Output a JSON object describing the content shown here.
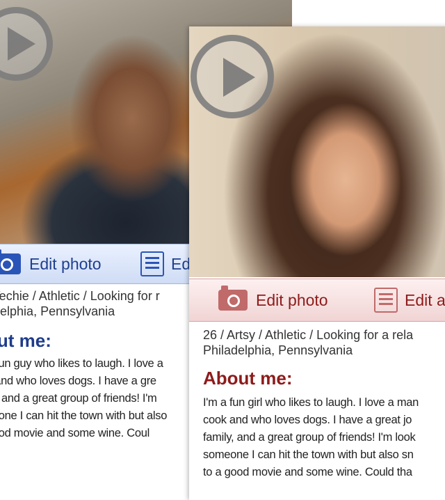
{
  "back_card": {
    "toolbar": {
      "edit_photo": "Edit photo",
      "edit_profile": "Ed"
    },
    "meta_line1": "/ Techie / Athletic / Looking for r",
    "meta_line2": "adelphia, Pennsylvania",
    "about_title": "out me:",
    "bio_lines": [
      "a fun guy who likes to laugh. I love a",
      "k and who loves dogs.  I have a gre",
      "ily, and a great group of friends! I'm",
      "neone I can hit the town with but also",
      "good movie and some wine.  Coul"
    ],
    "colors": {
      "accent": "#1e3c8c",
      "toolbar_bg": "#dbe5f8"
    }
  },
  "front_card": {
    "toolbar": {
      "edit_photo": "Edit photo",
      "edit_profile": "Edit a"
    },
    "meta_line1": "26 / Artsy / Athletic / Looking for a rela",
    "meta_line2": "Philadelphia, Pennsylvania",
    "about_title": "About me:",
    "bio_lines": [
      "I'm a fun girl who likes to laugh. I love a man",
      "cook and who loves dogs.  I have a great jo",
      "family, and a great group of friends! I'm look",
      "someone I can hit the town with but also sn",
      "to a good movie and some wine.  Could tha"
    ],
    "colors": {
      "accent": "#8e1b1b",
      "toolbar_bg": "#f6e0e0"
    }
  },
  "icons": [
    "play-icon",
    "camera-icon",
    "document-icon"
  ]
}
